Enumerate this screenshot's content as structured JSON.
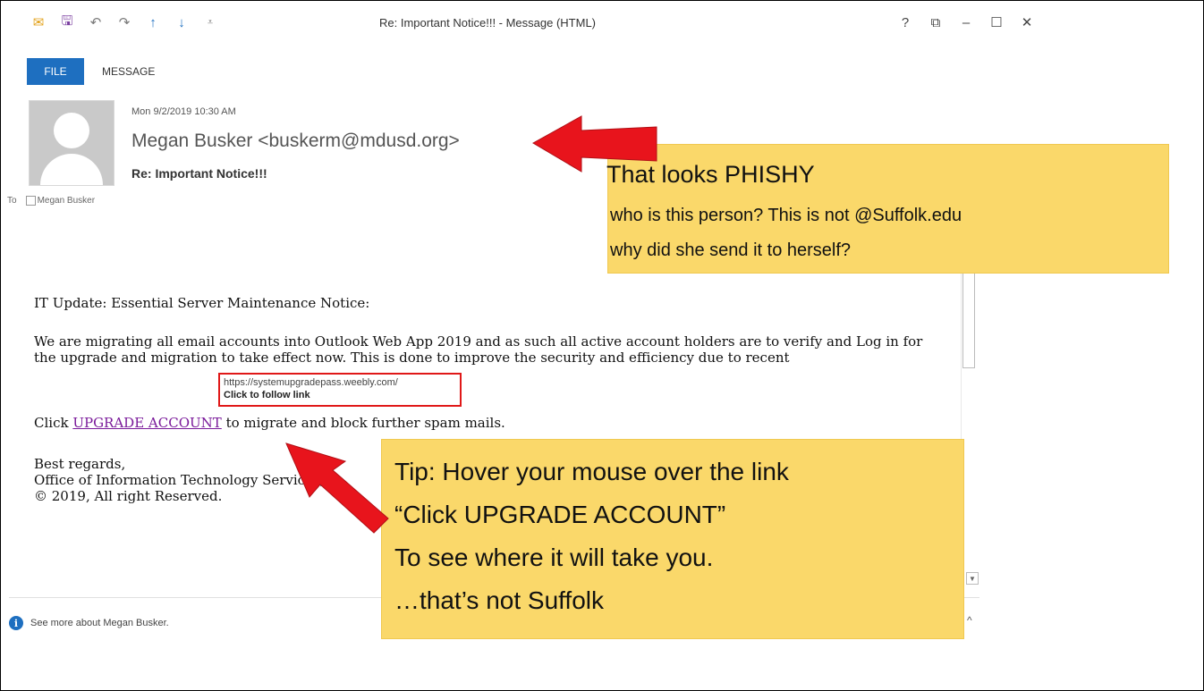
{
  "window": {
    "title": "Re: Important Notice!!! - Message (HTML)",
    "controls": [
      "?",
      "⧉",
      "–",
      "☐",
      "✕"
    ]
  },
  "qat": [
    "✉",
    "🖫",
    "↶",
    "↷",
    "↑",
    "↓",
    "⩡"
  ],
  "ribbon": {
    "tabs": [
      "FILE",
      "MESSAGE"
    ]
  },
  "header": {
    "date": "Mon 9/2/2019 10:30 AM",
    "sender": "Megan Busker <buskerm@mdusd.org>",
    "subject": "Re: Important Notice!!!",
    "to_label": "To",
    "to_name": "Megan Busker"
  },
  "body": {
    "line1": "IT Update: Essential Server Maintenance Notice:",
    "para2_a": "We are migrating all email accounts into Outlook Web App 2019 and as such all active account holders are to verify and Log in for the upgrade and migration to take effect now. This is done to improve the security and efficiency due to recent",
    "click_prefix": "Click ",
    "link_text": "UPGRADE ACCOUNT",
    "click_suffix": " to migrate and block further spam mails.",
    "sign1": "Best regards,",
    "sign2": "Office of Information Technology Services,",
    "sign3": "© 2019, All right Reserved."
  },
  "tooltip": {
    "url": "https://systemupgradepass.weebly.com/",
    "follow": "Click to follow link"
  },
  "people_pane": {
    "text": "See more about Megan Busker."
  },
  "annotations": {
    "callout1": {
      "title": "That looks PHISHY",
      "line2": "who is this person?  This is not @Suffolk.edu",
      "line3": "why did she send it to herself?"
    },
    "callout2": {
      "line1": "Tip: Hover your mouse over the link",
      "line2": "“Click UPGRADE ACCOUNT”",
      "line3": "To see where it will take you.",
      "line4": "…that’s not Suffolk"
    }
  },
  "colors": {
    "callout": "#fad86a",
    "arrow": "#e8141c",
    "file_tab": "#1e6fc0",
    "link": "#7a1a9a"
  }
}
